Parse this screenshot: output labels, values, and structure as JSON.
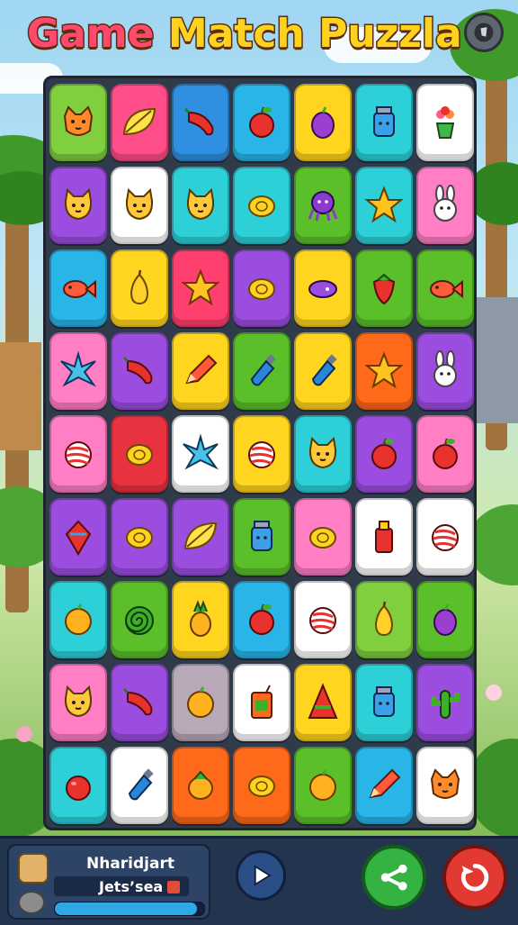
{
  "header": {
    "title_word1": "Game",
    "title_word2": "Match",
    "title_word3": "Puzzla"
  },
  "board": {
    "rows": [
      [
        {
          "color": "#7fcf3f",
          "icon": "fox-icon"
        },
        {
          "color": "#ff4d8a",
          "icon": "leaf-icon"
        },
        {
          "color": "#2f8fe0",
          "icon": "pepper-icon"
        },
        {
          "color": "#29b5e8",
          "icon": "apple-icon"
        },
        {
          "color": "#ffd51f",
          "icon": "grape-icon"
        },
        {
          "color": "#2ed0d8",
          "icon": "jar-icon"
        },
        {
          "color": "#ffffff",
          "icon": "flower-pot-icon"
        }
      ],
      [
        {
          "color": "#9b4de0",
          "icon": "cat-icon"
        },
        {
          "color": "#ffffff",
          "icon": "cat-icon"
        },
        {
          "color": "#2ed0d8",
          "icon": "cat-icon"
        },
        {
          "color": "#2ed0d8",
          "icon": "lemon-icon"
        },
        {
          "color": "#5bbf2a",
          "icon": "octopus-icon"
        },
        {
          "color": "#2ed0d8",
          "icon": "star-icon"
        },
        {
          "color": "#ff7ec4",
          "icon": "bunny-icon"
        }
      ],
      [
        {
          "color": "#29b5e8",
          "icon": "fish-icon"
        },
        {
          "color": "#ffd51f",
          "icon": "pear-icon"
        },
        {
          "color": "#ff3f6e",
          "icon": "star-icon"
        },
        {
          "color": "#9b4de0",
          "icon": "lemon-icon"
        },
        {
          "color": "#ffd51f",
          "icon": "candy-icon"
        },
        {
          "color": "#5bbf2a",
          "icon": "strawberry-icon"
        },
        {
          "color": "#5bbf2a",
          "icon": "fish-icon"
        }
      ],
      [
        {
          "color": "#ff7ec4",
          "icon": "starfish-icon"
        },
        {
          "color": "#9b4de0",
          "icon": "pepper-icon"
        },
        {
          "color": "#ffd51f",
          "icon": "pencil-icon"
        },
        {
          "color": "#5bbf2a",
          "icon": "bottle-icon"
        },
        {
          "color": "#ffd51f",
          "icon": "bottle-icon"
        },
        {
          "color": "#ff6a1a",
          "icon": "star-icon"
        },
        {
          "color": "#9b4de0",
          "icon": "bunny-icon"
        }
      ],
      [
        {
          "color": "#ff7ec4",
          "icon": "candy-stripe-icon"
        },
        {
          "color": "#e8323f",
          "icon": "lemon-icon"
        },
        {
          "color": "#ffffff",
          "icon": "starfish-icon"
        },
        {
          "color": "#ffd51f",
          "icon": "candy-stripe-icon"
        },
        {
          "color": "#2ed0d8",
          "icon": "cat-icon"
        },
        {
          "color": "#9b4de0",
          "icon": "apple-icon"
        },
        {
          "color": "#ff7ec4",
          "icon": "apple-icon"
        }
      ],
      [
        {
          "color": "#9b4de0",
          "icon": "spinning-top-icon"
        },
        {
          "color": "#9b4de0",
          "icon": "lemon-icon"
        },
        {
          "color": "#9b4de0",
          "icon": "leaf-icon"
        },
        {
          "color": "#5bbf2a",
          "icon": "jar-icon"
        },
        {
          "color": "#ff7ec4",
          "icon": "lemon-icon"
        },
        {
          "color": "#ffffff",
          "icon": "sauce-bottle-icon"
        },
        {
          "color": "#ffffff",
          "icon": "candy-stripe-icon"
        }
      ],
      [
        {
          "color": "#2ed0d8",
          "icon": "orange-icon"
        },
        {
          "color": "#5bbf2a",
          "icon": "spiral-icon"
        },
        {
          "color": "#ffd51f",
          "icon": "pineapple-icon"
        },
        {
          "color": "#29b5e8",
          "icon": "apple-icon"
        },
        {
          "color": "#ffffff",
          "icon": "candy-stripe-icon"
        },
        {
          "color": "#7fcf3f",
          "icon": "pear-icon"
        },
        {
          "color": "#5bbf2a",
          "icon": "grape-icon"
        }
      ],
      [
        {
          "color": "#ff7ec4",
          "icon": "cat-icon"
        },
        {
          "color": "#9b4de0",
          "icon": "pepper-icon"
        },
        {
          "color": "#b8a9b8",
          "icon": "orange-icon"
        },
        {
          "color": "#ffffff",
          "icon": "juice-box-icon"
        },
        {
          "color": "#ffd51f",
          "icon": "cone-icon"
        },
        {
          "color": "#2ed0d8",
          "icon": "jar-icon"
        },
        {
          "color": "#9b4de0",
          "icon": "cactus-icon"
        }
      ],
      [
        {
          "color": "#2ed0d8",
          "icon": "cherry-icon"
        },
        {
          "color": "#ffffff",
          "icon": "bottle-icon"
        },
        {
          "color": "#ff6a1a",
          "icon": "mango-icon"
        },
        {
          "color": "#ff6a1a",
          "icon": "lemon-icon"
        },
        {
          "color": "#5bbf2a",
          "icon": "orange-icon"
        },
        {
          "color": "#29b5e8",
          "icon": "pencil-icon"
        },
        {
          "color": "#ffffff",
          "icon": "fox-icon"
        }
      ]
    ]
  },
  "player": {
    "name": "Nharidjart",
    "subtitle": "Jetsʼsea",
    "progress": 0.95
  },
  "controls": {
    "play_icon": "play-icon",
    "share_icon": "share-icon",
    "restart_icon": "restart-icon"
  }
}
